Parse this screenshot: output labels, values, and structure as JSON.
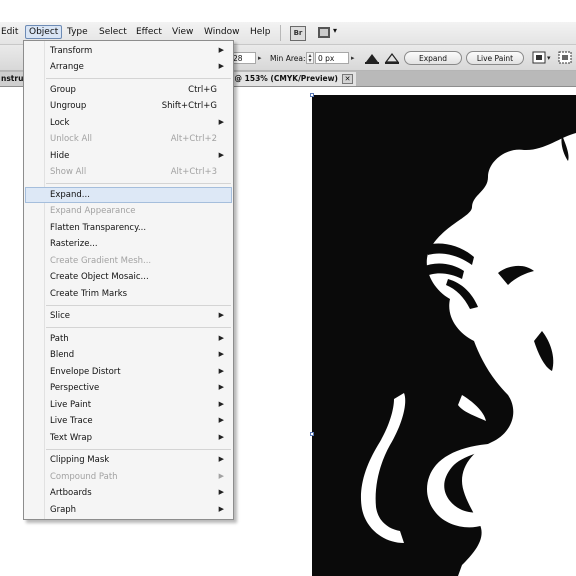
{
  "menubar": {
    "items": [
      "Edit",
      "Object",
      "Type",
      "Select",
      "Effect",
      "View",
      "Window",
      "Help"
    ],
    "active": "Object",
    "bridge_label": "Br"
  },
  "controlbar": {
    "field_value": "28",
    "min_area_label": "Min Area:",
    "min_area_value": "0 px",
    "expand_label": "Expand",
    "live_paint_label": "Live Paint"
  },
  "tabs": {
    "left_label": "nstruc",
    "doc_title": "* @ 153% (CMYK/Preview)",
    "close_glyph": "✕"
  },
  "menu": {
    "items": [
      {
        "label": "Transform",
        "shortcut": "",
        "submenu": true,
        "disabled": false
      },
      {
        "label": "Arrange",
        "shortcut": "",
        "submenu": true,
        "disabled": false
      },
      {
        "label": "Group",
        "shortcut": "Ctrl+G",
        "submenu": false,
        "disabled": false
      },
      {
        "label": "Ungroup",
        "shortcut": "Shift+Ctrl+G",
        "submenu": false,
        "disabled": false
      },
      {
        "label": "Lock",
        "shortcut": "",
        "submenu": true,
        "disabled": false
      },
      {
        "label": "Unlock All",
        "shortcut": "Alt+Ctrl+2",
        "submenu": false,
        "disabled": true
      },
      {
        "label": "Hide",
        "shortcut": "",
        "submenu": true,
        "disabled": false
      },
      {
        "label": "Show All",
        "shortcut": "Alt+Ctrl+3",
        "submenu": false,
        "disabled": true
      },
      {
        "label": "Expand...",
        "shortcut": "",
        "submenu": false,
        "disabled": false,
        "highlighted": true
      },
      {
        "label": "Expand Appearance",
        "shortcut": "",
        "submenu": false,
        "disabled": true
      },
      {
        "label": "Flatten Transparency...",
        "shortcut": "",
        "submenu": false,
        "disabled": false
      },
      {
        "label": "Rasterize...",
        "shortcut": "",
        "submenu": false,
        "disabled": false
      },
      {
        "label": "Create Gradient Mesh...",
        "shortcut": "",
        "submenu": false,
        "disabled": true
      },
      {
        "label": "Create Object Mosaic...",
        "shortcut": "",
        "submenu": false,
        "disabled": false
      },
      {
        "label": "Create Trim Marks",
        "shortcut": "",
        "submenu": false,
        "disabled": false
      },
      {
        "label": "Slice",
        "shortcut": "",
        "submenu": true,
        "disabled": false
      },
      {
        "label": "Path",
        "shortcut": "",
        "submenu": true,
        "disabled": false
      },
      {
        "label": "Blend",
        "shortcut": "",
        "submenu": true,
        "disabled": false
      },
      {
        "label": "Envelope Distort",
        "shortcut": "",
        "submenu": true,
        "disabled": false
      },
      {
        "label": "Perspective",
        "shortcut": "",
        "submenu": true,
        "disabled": false
      },
      {
        "label": "Live Paint",
        "shortcut": "",
        "submenu": true,
        "disabled": false
      },
      {
        "label": "Live Trace",
        "shortcut": "",
        "submenu": true,
        "disabled": false
      },
      {
        "label": "Text Wrap",
        "shortcut": "",
        "submenu": true,
        "disabled": false
      },
      {
        "label": "Clipping Mask",
        "shortcut": "",
        "submenu": true,
        "disabled": false
      },
      {
        "label": "Compound Path",
        "shortcut": "",
        "submenu": true,
        "disabled": true
      },
      {
        "label": "Artboards",
        "shortcut": "",
        "submenu": true,
        "disabled": false
      },
      {
        "label": "Graph",
        "shortcut": "",
        "submenu": true,
        "disabled": false
      }
    ]
  },
  "icons": {
    "submenu_arrow": "triangle-right-icon",
    "stepper": "stepper-icon",
    "gap_fill": "paint-bucket-icon",
    "gap_detect": "eraser-triangle-icon",
    "options": "live-paint-options-icon"
  },
  "colors": {
    "menu_highlight": "#dde8f6",
    "artboard": "#0a0a0a",
    "artwork": "#ffffff",
    "disabled_text": "#a2a2a2"
  }
}
